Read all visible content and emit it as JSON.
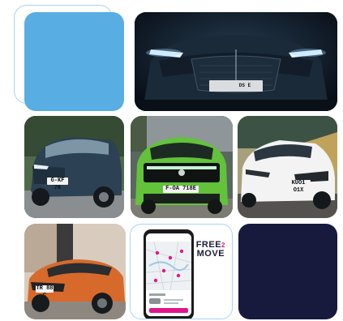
{
  "tiles": {
    "ds": {
      "badge": "DS E"
    },
    "suv": {
      "plate": "G-KF 76"
    },
    "mokka": {
      "plate": "F-OA 718E"
    },
    "corsa": {
      "plate": "KUO1 O1X"
    },
    "c4": {
      "plate": "TR 88 C"
    },
    "app": {
      "brand_line1": "FREE",
      "brand_two": "2",
      "brand_line2": "MOVE"
    }
  },
  "colors": {
    "blue_block": "#58aee2",
    "navy_block": "#17193d",
    "outline": "#a9d4ef",
    "accent_pink": "#e0168b"
  }
}
